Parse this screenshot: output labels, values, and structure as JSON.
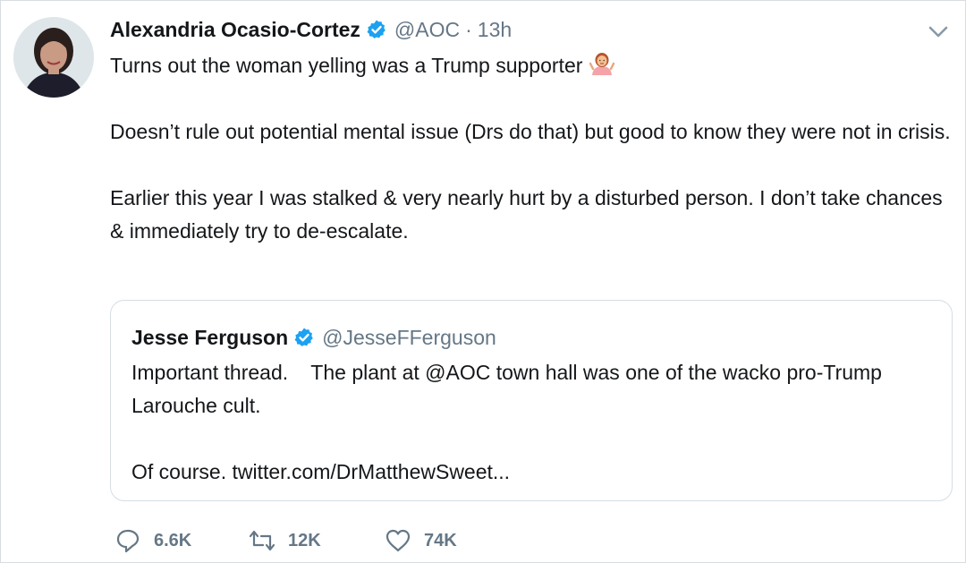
{
  "tweet": {
    "author_name": "Alexandria Ocasio-Cortez",
    "handle": "@AOC",
    "separator": "·",
    "time": "13h",
    "line1": "Turns out the woman yelling was a Trump supporter",
    "emoji_icon": "woman-shrugging-icon",
    "paragraph2": "Doesn’t rule out potential mental issue (Drs do that) but good to know they were not in crisis.",
    "paragraph3": "Earlier this year I was stalked & very nearly hurt by a disturbed person. I don’t take chances & immediately try to de-escalate."
  },
  "quote": {
    "author_name": "Jesse Ferguson",
    "handle": "@JesseFFerguson",
    "paragraph1": "Important thread.    The plant at @AOC town hall was one of the wacko pro-Trump Larouche cult.",
    "paragraph2": "Of course. twitter.com/DrMatthewSweet..."
  },
  "actions": {
    "replies": "6.6K",
    "retweets": "12K",
    "likes": "74K"
  },
  "colors": {
    "verified": "#1da1f2",
    "muted": "#657786",
    "text": "#14171a",
    "border": "#d6dde2"
  }
}
